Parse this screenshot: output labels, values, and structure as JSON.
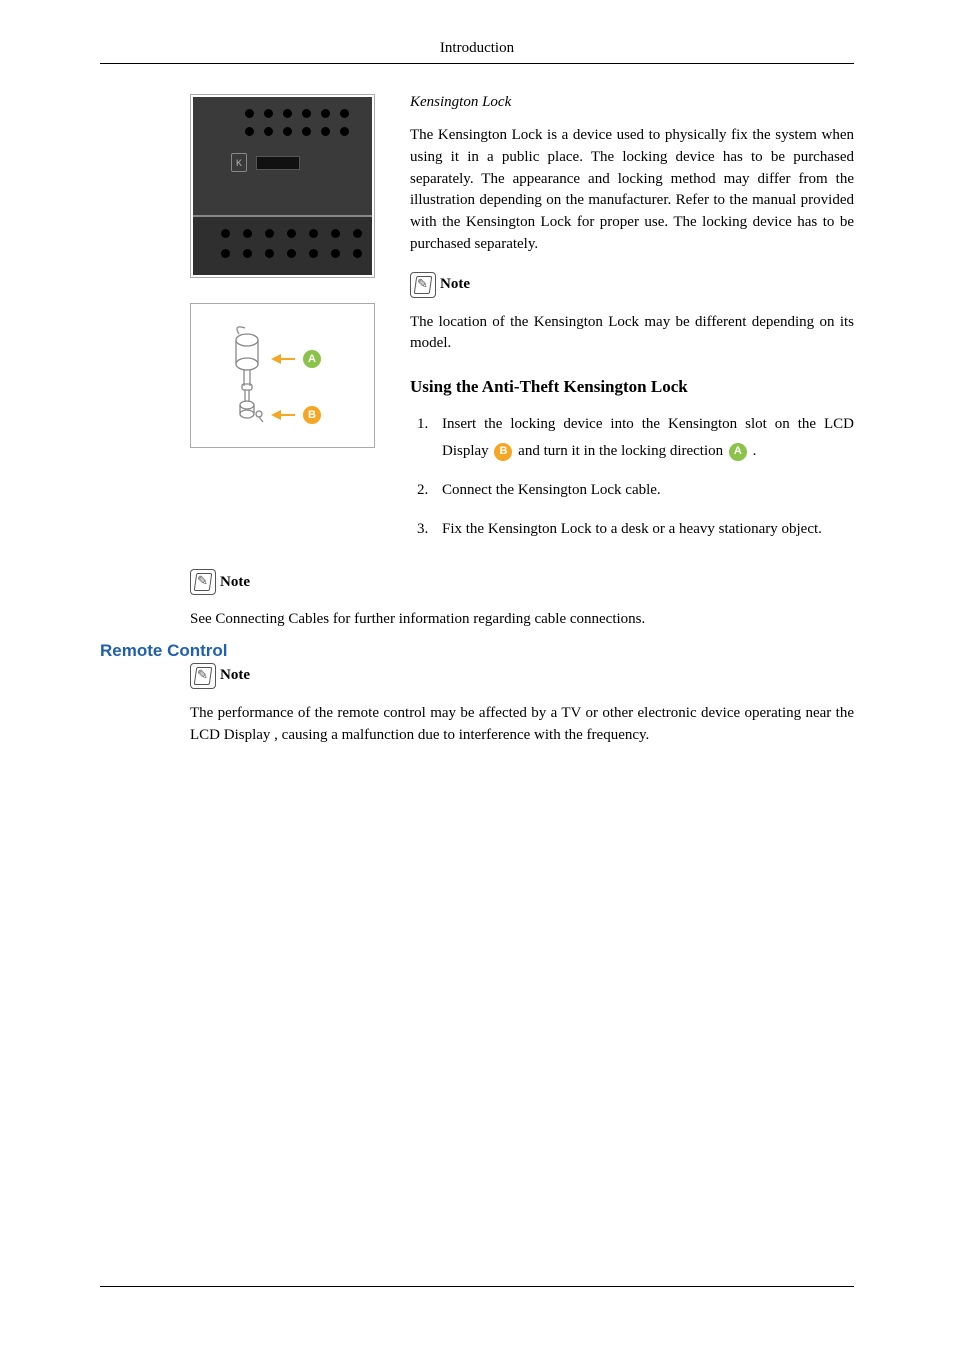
{
  "header": "Introduction",
  "kensington": {
    "title": "Kensington Lock",
    "description": "The Kensington Lock is a device used to physically fix the system when using it in a public place. The locking device has to be purchased separately. The appearance and locking method may differ from the illustration depending on the manufacturer. Refer to the manual provided with the Kensington Lock for proper use. The locking device has to be purchased separately."
  },
  "note_label": "Note",
  "note1_text": "The location of the Kensington Lock may be different depending on its model.",
  "sub_heading": "Using the Anti-Theft Kensington Lock",
  "steps": {
    "s1_a": "Insert the locking device into the Kensington slot on the LCD Display ",
    "s1_b": " and turn it in the locking direction ",
    "s1_c": ".",
    "s2": "Connect the Kensington Lock cable.",
    "s3": "Fix the Kensington Lock to a desk or a heavy stationary object."
  },
  "note2_text": "See Connecting Cables for further information regarding cable connections.",
  "remote": {
    "title": "Remote Control",
    "note_text": "The performance of the remote control may be affected by a TV or other electronic device operating near the LCD Display , causing a malfunction due to interference with the frequency."
  },
  "badges": {
    "a": "A",
    "b": "B"
  },
  "figure_k_label": "K"
}
